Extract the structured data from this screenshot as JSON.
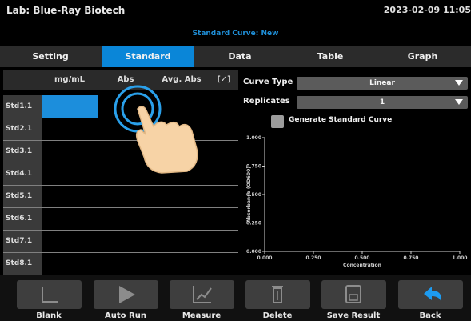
{
  "header": {
    "lab_title": "Lab: Blue-Ray Biotech",
    "date_time": "2023-02-09 11:05",
    "screen_title": "Standard Curve: New"
  },
  "tabs": [
    {
      "label": "Setting",
      "active": false
    },
    {
      "label": "Standard",
      "active": true
    },
    {
      "label": "Data",
      "active": false
    },
    {
      "label": "Table",
      "active": false
    },
    {
      "label": "Graph",
      "active": false
    }
  ],
  "table": {
    "columns": [
      "",
      "mg/mL",
      "Abs",
      "Avg. Abs",
      "[✓]"
    ],
    "rows": [
      "Std1.1",
      "Std2.1",
      "Std3.1",
      "Std4.1",
      "Std5.1",
      "Std6.1",
      "Std7.1",
      "Std8.1"
    ],
    "selected_cell": {
      "row": 0,
      "col": 1
    }
  },
  "controls": {
    "curve_type_label": "Curve Type",
    "curve_type_value": "Linear",
    "replicates_label": "Replicates",
    "replicates_value": "1",
    "generate_label": "Generate Standard Curve",
    "generate_checked": false
  },
  "chart_data": {
    "type": "scatter",
    "xlabel": "Concentration",
    "ylabel": "Absorbance (OD600)",
    "x_ticks": [
      "0.000",
      "0.250",
      "0.500",
      "0.750",
      "1.000"
    ],
    "y_ticks": [
      "0.000",
      "0.250",
      "0.500",
      "0.750",
      "1.000"
    ],
    "xlim": [
      0,
      1
    ],
    "ylim": [
      0,
      1
    ],
    "series": []
  },
  "toolbar": [
    {
      "label": "Blank",
      "icon": "blank-icon"
    },
    {
      "label": "Auto Run",
      "icon": "play-icon"
    },
    {
      "label": "Measure",
      "icon": "measure-chart-icon"
    },
    {
      "label": "Delete",
      "icon": "trash-icon"
    },
    {
      "label": "Save Result",
      "icon": "save-icon"
    },
    {
      "label": "Back",
      "icon": "back-arrow-icon"
    }
  ],
  "colors": {
    "accent": "#0a86d8",
    "back_icon": "#1d9bf0",
    "hand": "#f7d3a6"
  }
}
